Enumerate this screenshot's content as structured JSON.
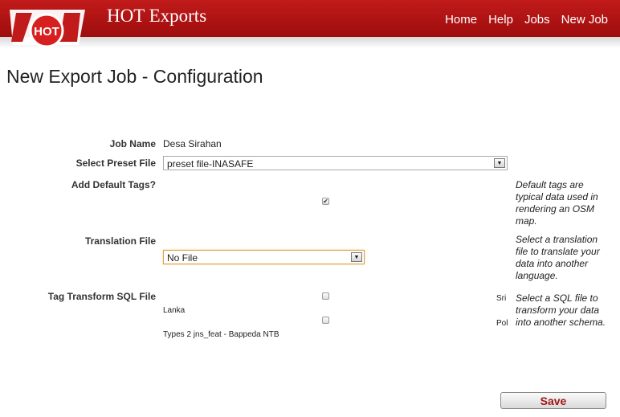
{
  "header": {
    "logo_text": "HOT",
    "site_title": "HOT Exports",
    "nav": [
      "Home",
      "Help",
      "Jobs",
      "New Job"
    ]
  },
  "page_title": "New Export Job - Configuration",
  "form": {
    "job_name_label": "Job Name",
    "job_name_value": "Desa Sirahan",
    "preset_label": "Select Preset File",
    "preset_value": "preset file-INASAFE",
    "default_tags_label": "Add Default Tags?",
    "default_tags_checked": true,
    "default_tags_help": "Default tags are typical data used in rendering an OSM map.",
    "translation_label": "Translation File",
    "translation_value": "No File",
    "translation_help": "Select a translation file to translate your data into another language.",
    "transform_label": "Tag Transform SQL File",
    "transform_options": [
      {
        "prefix": "Sri",
        "label": "Lanka"
      },
      {
        "prefix": "Pol",
        "label": "Types 2 jns_feat - Bappeda NTB"
      }
    ],
    "transform_help": "Select a SQL file to transform your data into another schema."
  },
  "save_label": "Save"
}
